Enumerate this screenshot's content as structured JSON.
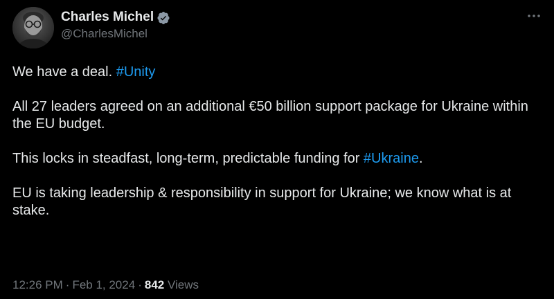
{
  "author": {
    "display_name": "Charles Michel",
    "handle": "@CharlesMichel",
    "verified_icon": "verified-badge-icon",
    "avatar_icon": "avatar-photo"
  },
  "menu_icon": "more-horizontal-icon",
  "tweet": {
    "paragraphs": [
      {
        "text": "We have a deal. ",
        "hashtag": "#Unity",
        "after": ""
      },
      {
        "text": "All 27 leaders agreed on an additional €50 billion support package for Ukraine within the EU budget.",
        "hashtag": "",
        "after": ""
      },
      {
        "text": "This locks in steadfast, long-term, predictable funding for ",
        "hashtag": "#Ukraine",
        "after": "."
      },
      {
        "text": "EU is taking leadership & responsibility in support for Ukraine; we know what is at stake.",
        "hashtag": "",
        "after": ""
      }
    ]
  },
  "meta": {
    "time": "12:26 PM",
    "date": "Feb 1, 2024",
    "views_count": "842",
    "views_label": "Views",
    "separator": "·"
  },
  "colors": {
    "background": "#000000",
    "text": "#e7e9ea",
    "muted": "#71767b",
    "link": "#1d9bf0"
  }
}
